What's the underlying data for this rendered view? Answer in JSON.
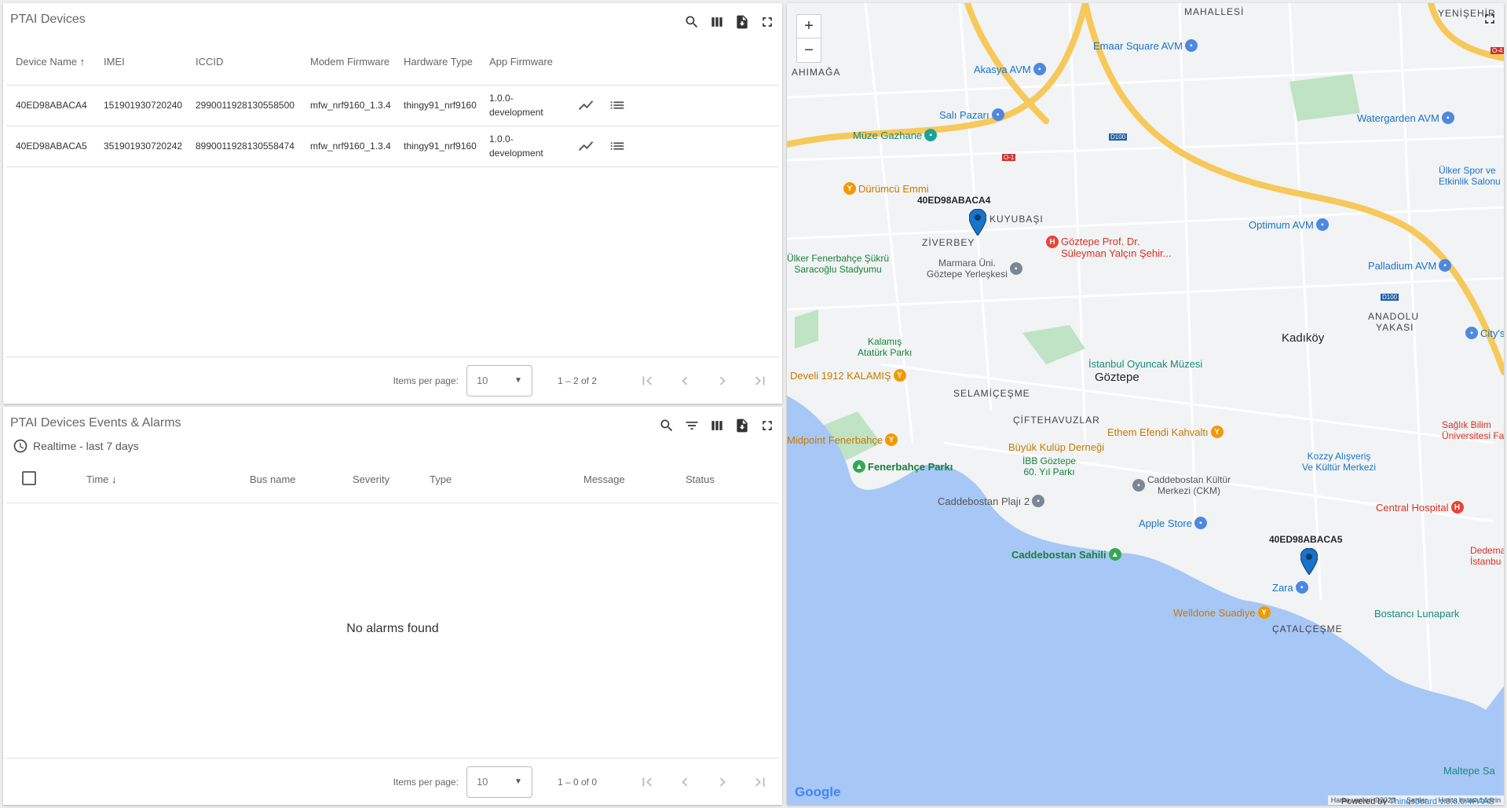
{
  "devices_widget": {
    "title": "PTAI Devices",
    "columns": [
      "Device Name",
      "IMEI",
      "ICCID",
      "Modem Firmware",
      "Hardware Type",
      "App Firmware"
    ],
    "rows": [
      {
        "name": "40ED98ABACA4",
        "imei": "151901930720240",
        "iccid": "2990011928130558500",
        "modem": "mfw_nrf9160_1.3.4",
        "hw": "thingy91_nrf9160",
        "app": "1.0.0-development"
      },
      {
        "name": "40ED98ABACA5",
        "imei": "351901930720242",
        "iccid": "8990011928130558474",
        "modem": "mfw_nrf9160_1.3.4",
        "hw": "thingy91_nrf9160",
        "app": "1.0.0-development"
      }
    ],
    "items_per_page_label": "Items per page:",
    "page_size": "10",
    "range": "1 – 2 of 2"
  },
  "alarms_widget": {
    "title": "PTAI Devices Events & Alarms",
    "timewindow": "Realtime - last 7 days",
    "columns": [
      "Time",
      "Bus name",
      "Severity",
      "Type",
      "Message",
      "Status"
    ],
    "empty": "No alarms found",
    "items_per_page_label": "Items per page:",
    "page_size": "10",
    "range": "1 – 0 of 0"
  },
  "map_widget": {
    "zoom_in": "+",
    "zoom_out": "−",
    "markers": [
      {
        "label": "40ED98ABACA4"
      },
      {
        "label": "40ED98ABACA5"
      }
    ],
    "districts": {
      "mahallesi": "MAHALLESİ",
      "yenisehir": "YENİŞEHİR",
      "ahimaga": "AHIMAĞA",
      "kuyubasi": "KUYUBAŞI",
      "ziverbey": "ZİVERBEY",
      "kadikoy": "Kadıköy",
      "anadolu": "ANADOLU",
      "yakasi": "YAKASI",
      "selamicesme": "SELAMİÇEŞME",
      "goztepe": "Göztepe",
      "ciftehavuzlar": "ÇİFTEHAVUZLAR",
      "catalcesme": "ÇATALÇEŞME"
    },
    "pois": {
      "emaar": "Emaar Square AVM",
      "akasya": "Akasya AVM",
      "sali": "Salı Pazarı",
      "muze": "Müze Gazhane",
      "watergarden": "Watergarden AVM",
      "durumcu": "Dürümcü Emmi",
      "optimum": "Optimum AVM",
      "goztepe_hosp1": "Göztepe Prof. Dr.",
      "goztepe_hosp2": "Süleyman Yalçın Şehir...",
      "marmara1": "Marmara Üni.",
      "marmara2": "Göztepe Yerleşkesi",
      "ulker1": "Ülker Fenerbahçe Şükrü",
      "ulker2": "Saracoğlu Stadyumu",
      "palladium": "Palladium AVM",
      "ulker_spor1": "Ülker Spor ve",
      "ulker_spor2": "Etkinlik Salonu",
      "kalamis1": "Kalamış",
      "kalamis2": "Atatürk Parkı",
      "develi": "Develi 1912 KALAMIŞ",
      "oyuncak": "İstanbul Oyuncak Müzesi",
      "citys": "City's",
      "midpoint": "Midpoint Fenerbahçe",
      "ethem": "Ethem Efendi Kahvaltı",
      "buyuk": "Büyük Kulüp Derneği",
      "ibb1": "İBB Göztepe",
      "ibb2": "60. Yıl Parkı",
      "fenerbahce": "Fenerbahçe Parkı",
      "caddebostan_kultur1": "Caddebostan Kültür",
      "caddebostan_kultur2": "Merkezi (CKM)",
      "kozzy1": "Kozzy Alışveriş",
      "kozzy2": "Ve Kültür Merkezi",
      "saglik1": "Sağlık Bilim",
      "saglik2": "Üniversitesi Fa",
      "plaji": "Caddebostan Plajı 2",
      "central": "Central Hospital",
      "apple": "Apple Store",
      "sahili": "Caddebostan Sahili",
      "dedeman1": "Dedema",
      "dedeman2": "İstanbu",
      "zara": "Zara",
      "welldone": "Welldone Suadiye",
      "lunapark": "Bostancı Lunapark",
      "maltepe": "Maltepe Sa"
    },
    "roads": {
      "d100a": "D100",
      "d100b": "D100",
      "o1": "O-1",
      "o4": "O-4"
    },
    "attribution": [
      "Harita verileri ©2023",
      "Şartlar",
      "Harita hatası bildirin"
    ],
    "google": "Google",
    "powered_prefix": "Powered by ",
    "powered_link": "Thingsboard v.3.6.0.4PAAS"
  },
  "colors": {
    "water": "#a7c7f7",
    "land": "#f1f3f4",
    "park": "#bfe3c4",
    "highway": "#f7c85a",
    "marker": "#1a73c8"
  }
}
